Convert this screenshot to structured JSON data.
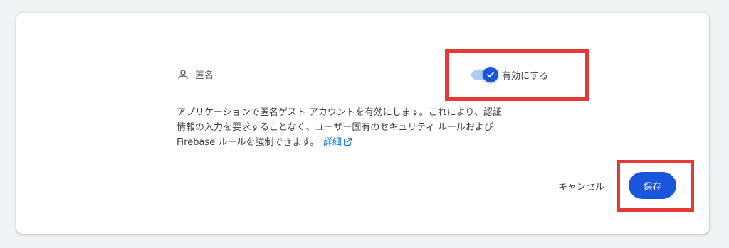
{
  "provider": {
    "name": "匿名",
    "icon": "person-icon"
  },
  "toggle": {
    "label": "有効にする",
    "enabled": true,
    "accent": "#1a56db"
  },
  "description": {
    "line1": "アプリケーションで匿名ゲスト アカウントを有効にします。これにより、認証",
    "line2": "情報の入力を要求することなく、ユーザー固有のセキュリティ ルールおよび",
    "line3": "Firebase ルールを強制できます。",
    "link_text": "詳細",
    "link_icon": "open-in-new-icon"
  },
  "actions": {
    "cancel_label": "キャンセル",
    "save_label": "保存"
  },
  "colors": {
    "highlight": "#e53935",
    "primary": "#1a56db",
    "link": "#1a73e8"
  }
}
